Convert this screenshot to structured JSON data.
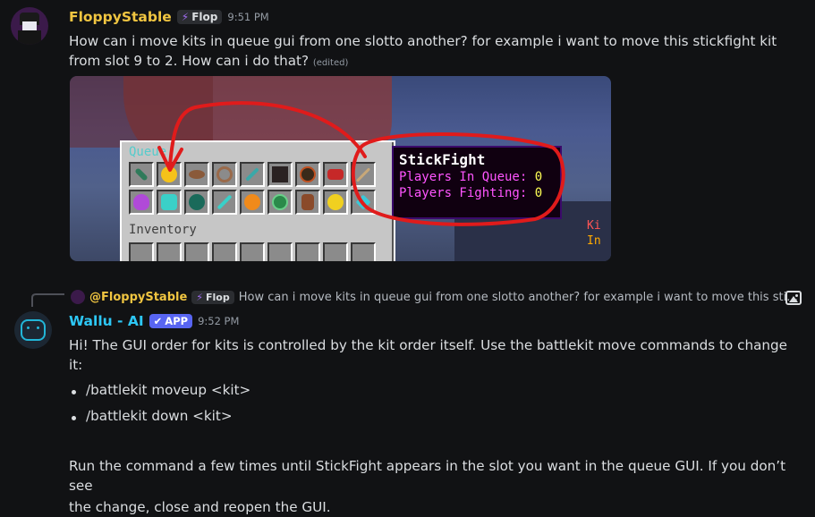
{
  "message1": {
    "username": "FloppyStable",
    "tag": "Flop",
    "timestamp": "9:51 PM",
    "text": "How can i move kits in queue gui from one slotto another? for example i want to move this stickfight kit from slot 9 to 2. How can i do that?",
    "edited": "(edited)",
    "screenshot": {
      "gui_title": "Queue",
      "inventory_label": "Inventory",
      "tooltip_title": "StickFight",
      "tooltip_line1_label": "Players In Queue:",
      "tooltip_line1_value": "0",
      "tooltip_line2_label": "Players Fighting:",
      "tooltip_line2_value": "0",
      "side_text_1": "Ki",
      "side_text_2": "In"
    }
  },
  "reply": {
    "username": "@FloppyStable",
    "tag": "Flop",
    "text": "How can i move kits in queue gui from one slotto another? for example i want to move this sti…"
  },
  "message2": {
    "username": "Wallu - AI",
    "badge": "APP",
    "timestamp": "9:52 PM",
    "intro": "Hi! The GUI order for kits is controlled by the kit order itself. Use the battlekit move commands to change it:",
    "bullets": [
      "/battlekit moveup <kit>",
      "/battlekit down <kit>"
    ],
    "outro_line1": "Run the command a few times until StickFight appears in the slot you want in the queue GUI. If you don’t see",
    "outro_line2": "the change, close and reopen the GUI."
  },
  "colors": {
    "floppy_name": "#f0c541",
    "wallu_name": "#2dc7f5",
    "app_badge": "#5865f2",
    "annotation_red": "#e01b1b"
  }
}
